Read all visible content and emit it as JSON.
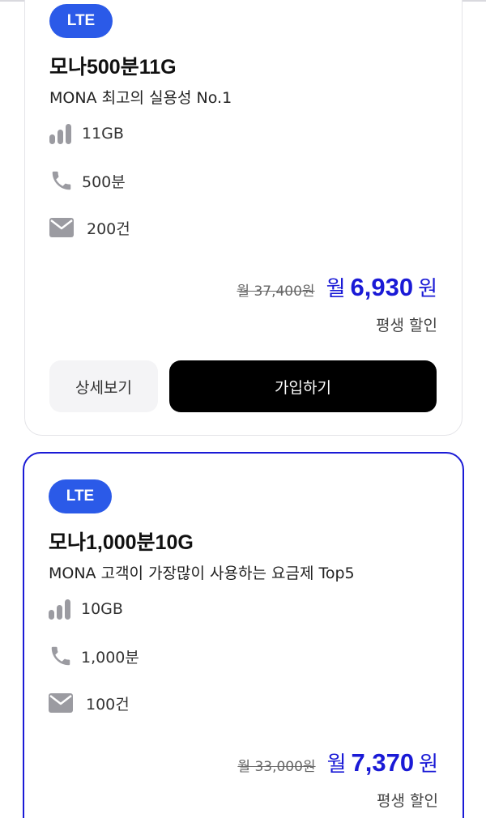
{
  "colors": {
    "accent": "#1a1ad6",
    "badge": "#2b5ae8",
    "join_button": "#000000",
    "detail_button": "#f4f4f6",
    "icon_gray": "#9b9ba1"
  },
  "plans": [
    {
      "badge": "LTE",
      "title": "모나500분11G",
      "subtitle": "MONA 최고의 실용성 No.1",
      "data": "11GB",
      "voice": "500분",
      "sms": "200건",
      "original_price": "월 37,400원",
      "month_label": "월",
      "price": "6,930",
      "currency": "원",
      "discount_label": "평생 할인",
      "detail_button": "상세보기",
      "join_button": "가입하기",
      "selected": false
    },
    {
      "badge": "LTE",
      "title": "모나1,000분10G",
      "subtitle": "MONA 고객이 가장많이 사용하는 요금제 Top5",
      "data": "10GB",
      "voice": "1,000분",
      "sms": "100건",
      "original_price": "월 33,000원",
      "month_label": "월",
      "price": "7,370",
      "currency": "원",
      "discount_label": "평생 할인",
      "selected": true
    }
  ],
  "icons": {
    "data": "signal-bars-icon",
    "voice": "phone-icon",
    "sms": "envelope-icon"
  }
}
